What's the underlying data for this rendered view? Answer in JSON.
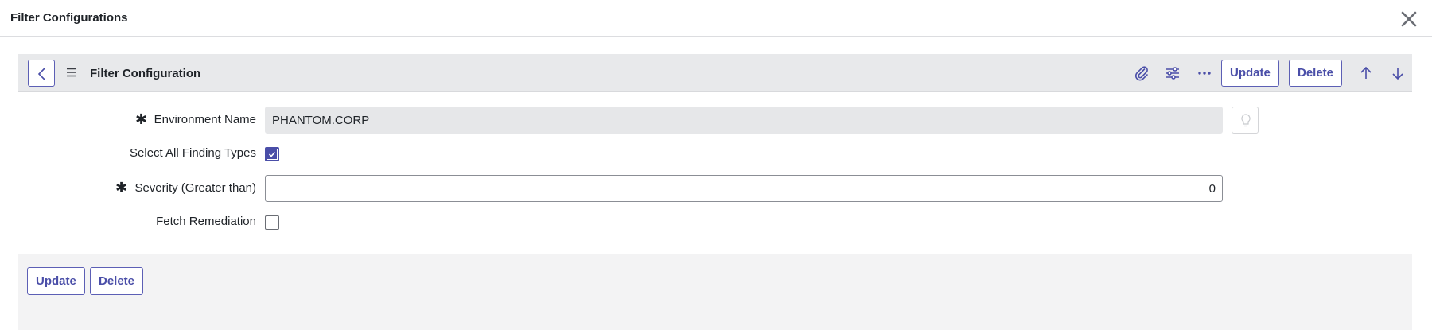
{
  "modal": {
    "title": "Filter Configurations",
    "close_icon": "close-icon"
  },
  "form_header": {
    "title": "Filter Configuration",
    "icons": [
      "back-icon",
      "menu-icon",
      "paperclip-icon",
      "sliders-icon",
      "more-icon",
      "arrow-up-icon",
      "arrow-down-icon"
    ],
    "update_label": "Update",
    "delete_label": "Delete"
  },
  "fields": {
    "environment_name": {
      "label": "Environment Name",
      "value": "PHANTOM.CORP",
      "required": true
    },
    "select_all_finding_types": {
      "label": "Select All Finding Types",
      "checked": true
    },
    "severity": {
      "label": "Severity (Greater than)",
      "value": "0",
      "required": true
    },
    "fetch_remediation": {
      "label": "Fetch Remediation",
      "checked": false
    }
  },
  "footer": {
    "update_label": "Update",
    "delete_label": "Delete"
  },
  "colors": {
    "accent": "#4a4ea8",
    "header_bg": "#e8e9eb",
    "footer_bg": "#f3f3f4"
  }
}
